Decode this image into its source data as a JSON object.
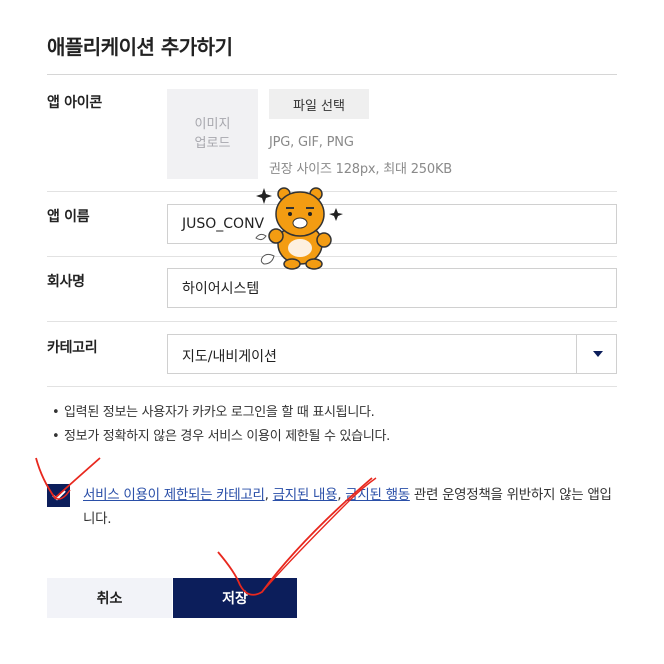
{
  "page": {
    "title": "애플리케이션 추가하기"
  },
  "app_icon": {
    "label": "앱 아이콘",
    "upload_text_line1": "이미지",
    "upload_text_line2": "업로드",
    "file_button": "파일 선택",
    "hint_formats": "JPG, GIF, PNG",
    "hint_size": "권장 사이즈 128px, 최대 250KB"
  },
  "app_name": {
    "label": "앱 이름",
    "value": "JUSO_CONV"
  },
  "company": {
    "label": "회사명",
    "value": "하이어시스템"
  },
  "category": {
    "label": "카테고리",
    "selected": "지도/내비게이션"
  },
  "notes": [
    "입력된 정보는 사용자가 카카오 로그인을 할 때 표시됩니다.",
    "정보가 정확하지 않은 경우 서비스 이용이 제한될 수 있습니다."
  ],
  "agreement": {
    "checked": true,
    "link1": "서비스 이용이 제한되는 카테고리",
    "comma": ",",
    "link2": "금지된 내용",
    "link3": "금지된 행동",
    "text_after": " 관련 운영정책을 위반하지 않는 앱입니다."
  },
  "buttons": {
    "cancel": "취소",
    "save": "저장"
  },
  "colors": {
    "primary": "#0c1e5b",
    "link": "#2a4fa8",
    "annotation": "#e8281e",
    "mascot": "#f39c12"
  },
  "decorations": {
    "mascot": "ryan-character-sticker",
    "annotation": "red-handwritten-strokes"
  }
}
